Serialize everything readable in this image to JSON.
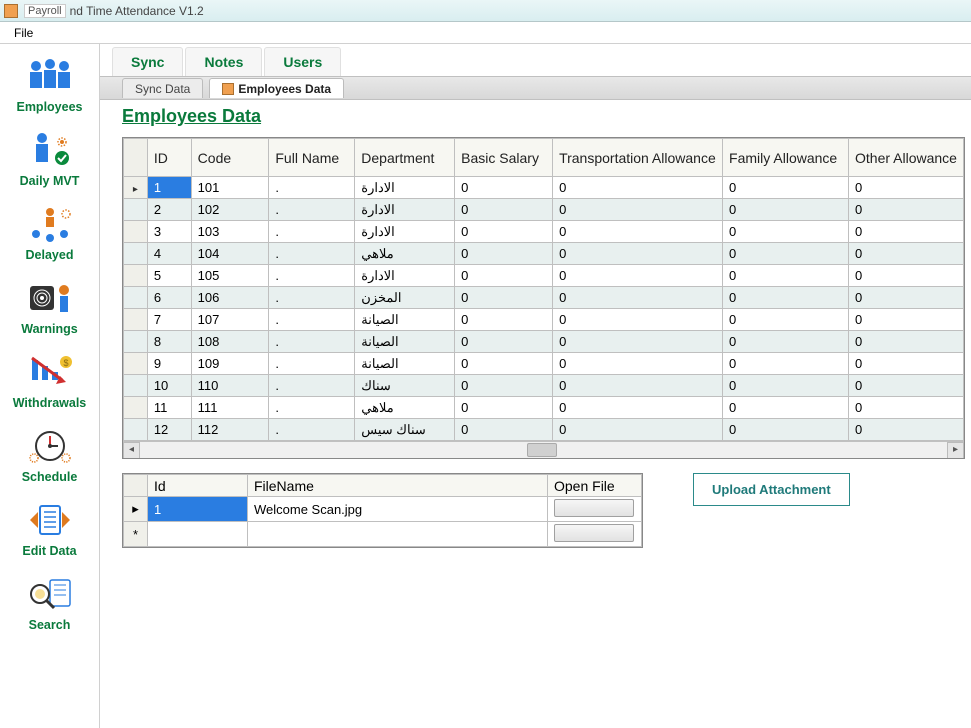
{
  "titlebar": {
    "payroll_label": "Payroll",
    "title_text": "nd Time Attendance V1.2"
  },
  "menubar": {
    "file": "File"
  },
  "sidebar": {
    "items": [
      {
        "label": "Employees"
      },
      {
        "label": "Daily MVT"
      },
      {
        "label": "Delayed"
      },
      {
        "label": "Warnings"
      },
      {
        "label": "Withdrawals"
      },
      {
        "label": "Schedule"
      },
      {
        "label": "Edit Data"
      },
      {
        "label": "Search"
      }
    ]
  },
  "toptabs": {
    "sync": "Sync",
    "notes": "Notes",
    "users": "Users"
  },
  "subtabs": {
    "sync_data": "Sync Data",
    "employees_data": "Employees Data"
  },
  "page_title": "Employees Data",
  "grid": {
    "headers": {
      "id": "ID",
      "code": "Code",
      "full_name": "Full\nName",
      "department": "Department",
      "basic_salary": "Basic\nSalary",
      "transport": "Transportation\nAllowance",
      "family": "Family\nAllowance",
      "other": "Other\nAllowance"
    },
    "rows": [
      {
        "id": "1",
        "code": "101",
        "name": ".",
        "dept": "الادارة",
        "sal": "0",
        "ta": "0",
        "fa": "0",
        "oa": "0"
      },
      {
        "id": "2",
        "code": "102",
        "name": ".",
        "dept": "الادارة",
        "sal": "0",
        "ta": "0",
        "fa": "0",
        "oa": "0"
      },
      {
        "id": "3",
        "code": "103",
        "name": ".",
        "dept": "الادارة",
        "sal": "0",
        "ta": "0",
        "fa": "0",
        "oa": "0"
      },
      {
        "id": "4",
        "code": "104",
        "name": ".",
        "dept": "ملاهي",
        "sal": "0",
        "ta": "0",
        "fa": "0",
        "oa": "0"
      },
      {
        "id": "5",
        "code": "105",
        "name": ".",
        "dept": "الادارة",
        "sal": "0",
        "ta": "0",
        "fa": "0",
        "oa": "0"
      },
      {
        "id": "6",
        "code": "106",
        "name": ".",
        "dept": "المخزن",
        "sal": "0",
        "ta": "0",
        "fa": "0",
        "oa": "0"
      },
      {
        "id": "7",
        "code": "107",
        "name": ".",
        "dept": "الصيانة",
        "sal": "0",
        "ta": "0",
        "fa": "0",
        "oa": "0"
      },
      {
        "id": "8",
        "code": "108",
        "name": ".",
        "dept": "الصيانة",
        "sal": "0",
        "ta": "0",
        "fa": "0",
        "oa": "0"
      },
      {
        "id": "9",
        "code": "109",
        "name": ".",
        "dept": "الصيانة",
        "sal": "0",
        "ta": "0",
        "fa": "0",
        "oa": "0"
      },
      {
        "id": "10",
        "code": "110",
        "name": ".",
        "dept": "سناك",
        "sal": "0",
        "ta": "0",
        "fa": "0",
        "oa": "0"
      },
      {
        "id": "11",
        "code": "111",
        "name": ".",
        "dept": "ملاهي",
        "sal": "0",
        "ta": "0",
        "fa": "0",
        "oa": "0"
      },
      {
        "id": "12",
        "code": "112",
        "name": ".",
        "dept": "سناك سيس",
        "sal": "0",
        "ta": "0",
        "fa": "0",
        "oa": "0"
      }
    ]
  },
  "attachments": {
    "headers": {
      "id": "Id",
      "filename": "FileName",
      "open": "Open File"
    },
    "rows": [
      {
        "id": "1",
        "filename": "Welcome Scan.jpg"
      }
    ],
    "upload_button": "Upload Attachment"
  }
}
